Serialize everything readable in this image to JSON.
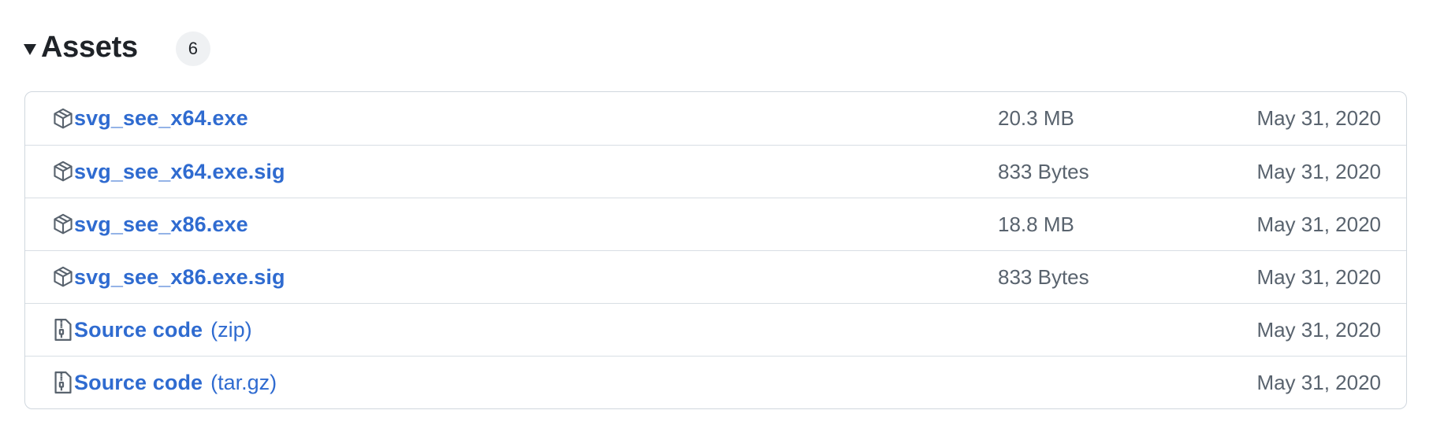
{
  "assets": {
    "title": "Assets",
    "count": "6",
    "rows": [
      {
        "icon": "package-icon",
        "name": "svg_see_x64.exe",
        "suffix": "",
        "size": "20.3 MB",
        "date": "May 31, 2020"
      },
      {
        "icon": "package-icon",
        "name": "svg_see_x64.exe.sig",
        "suffix": "",
        "size": "833 Bytes",
        "date": "May 31, 2020"
      },
      {
        "icon": "package-icon",
        "name": "svg_see_x86.exe",
        "suffix": "",
        "size": "18.8 MB",
        "date": "May 31, 2020"
      },
      {
        "icon": "package-icon",
        "name": "svg_see_x86.exe.sig",
        "suffix": "",
        "size": "833 Bytes",
        "date": "May 31, 2020"
      },
      {
        "icon": "file-zip-icon",
        "name": "Source code",
        "suffix": "(zip)",
        "size": "",
        "date": "May 31, 2020"
      },
      {
        "icon": "file-zip-icon",
        "name": "Source code",
        "suffix": "(tar.gz)",
        "size": "",
        "date": "May 31, 2020"
      }
    ]
  },
  "colors": {
    "link": "#2f6bd0",
    "muted_text": "#59636e",
    "heading": "#1f2328",
    "border": "#d0d7de",
    "badge_bg": "#eff1f3"
  }
}
